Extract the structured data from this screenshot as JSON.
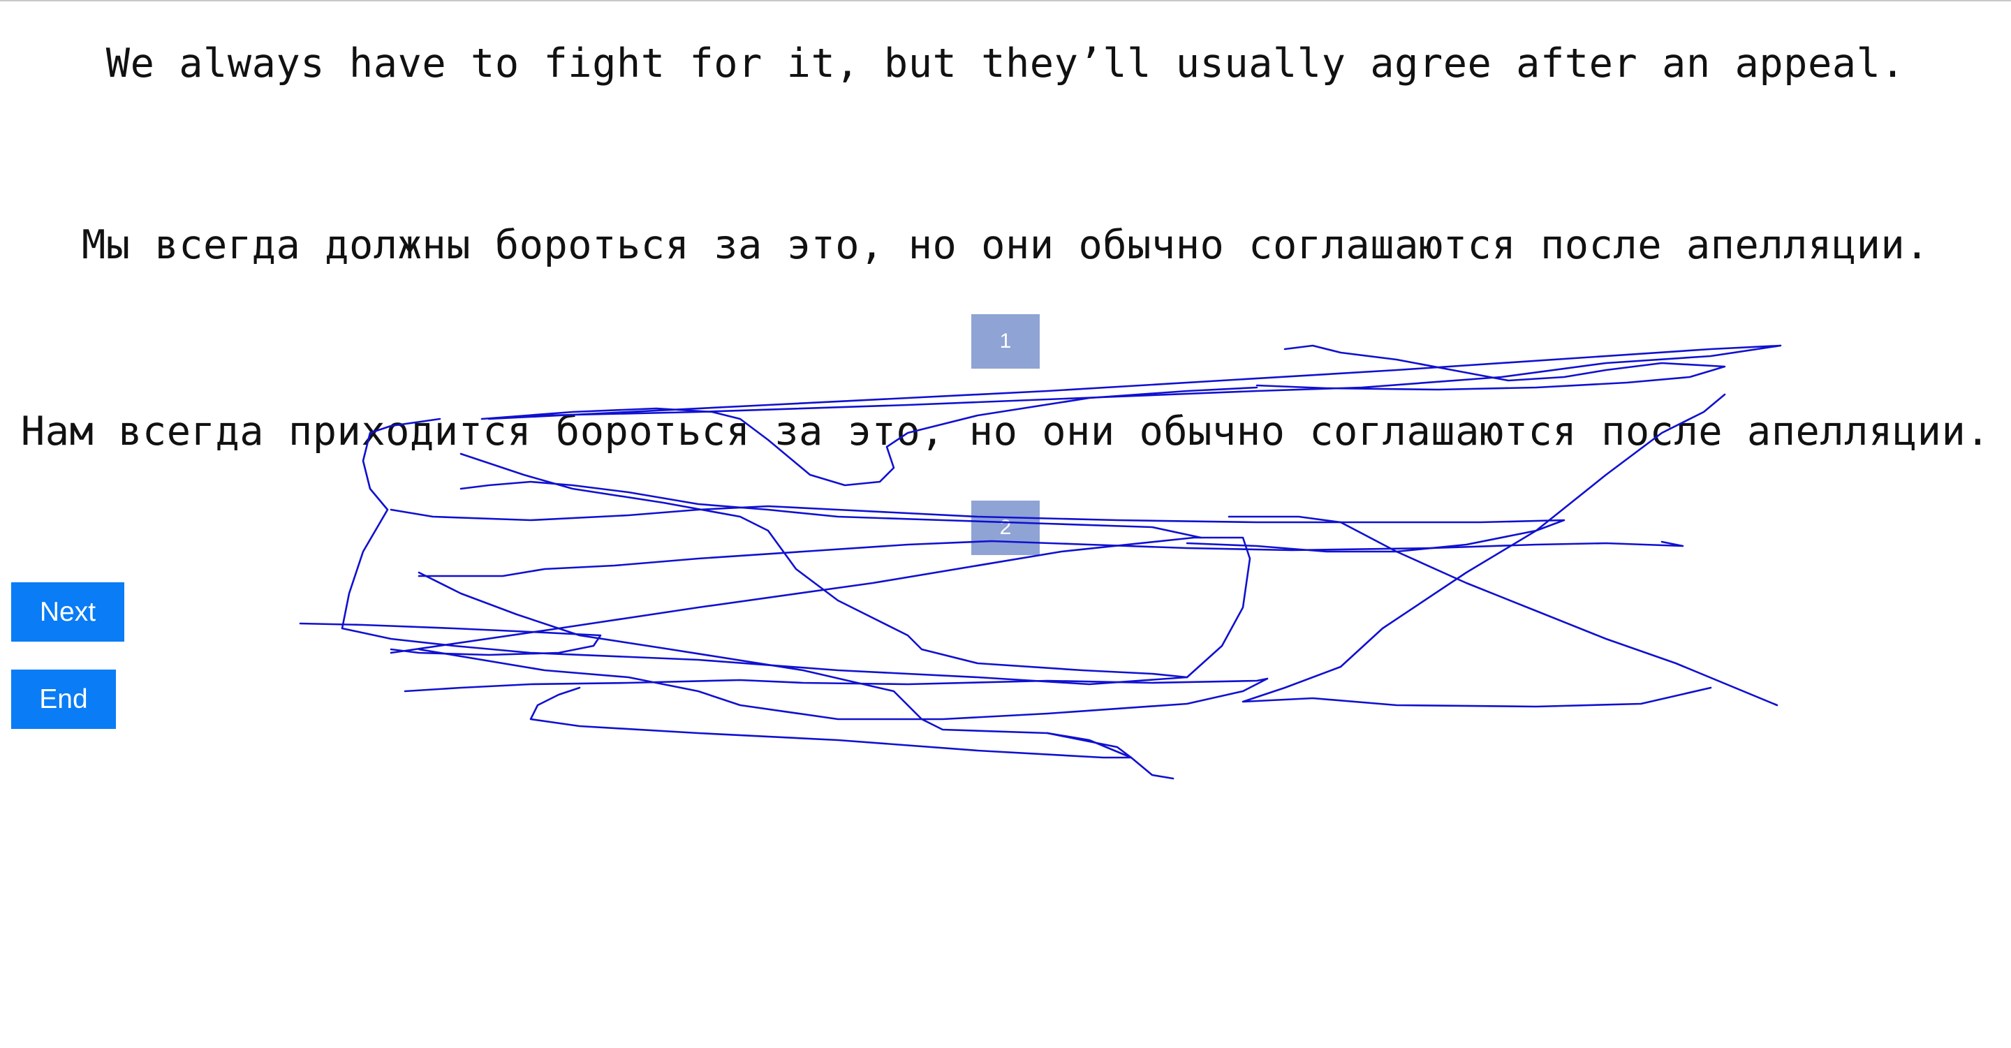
{
  "source_sentence": "We always have to fight for it, but they’ll usually agree after an appeal.",
  "translations": [
    "Мы всегда должны бороться за это, но они обычно соглашаются после апелляции.",
    "Нам всегда приходится бороться за это, но они обычно соглашаются после апелляции."
  ],
  "choices": [
    "1",
    "2"
  ],
  "buttons": {
    "next_label": "Next",
    "end_label": "End"
  },
  "colors": {
    "choice_button": "#8fa3d4",
    "action_button": "#0a7cf5",
    "annotation_stroke": "#1010d0"
  }
}
